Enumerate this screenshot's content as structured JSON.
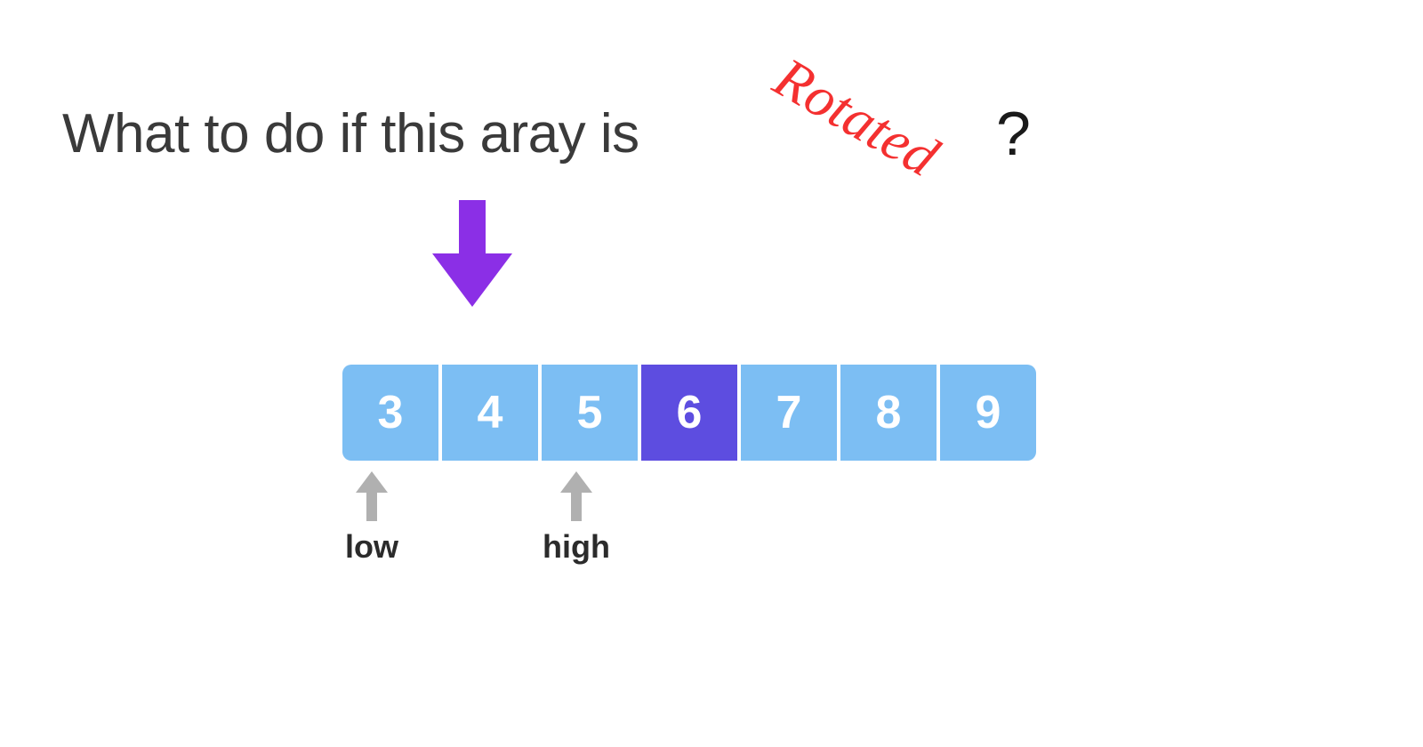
{
  "heading": "What to do if this aray is",
  "rotated_label": "Rotated",
  "question_mark": "?",
  "array": {
    "cells": [
      "3",
      "4",
      "5",
      "6",
      "7",
      "8",
      "9"
    ],
    "highlight_index": 3
  },
  "pointers": {
    "low": {
      "label": "low",
      "index": 0
    },
    "high": {
      "label": "high",
      "index": 2
    }
  },
  "colors": {
    "cell": "#7cbef3",
    "highlight": "#5d4de0",
    "arrow": "#8b2fe6",
    "rotated": "#f43030",
    "heading": "#3a3a3a",
    "pointer_arrow": "#b0b0b0"
  }
}
